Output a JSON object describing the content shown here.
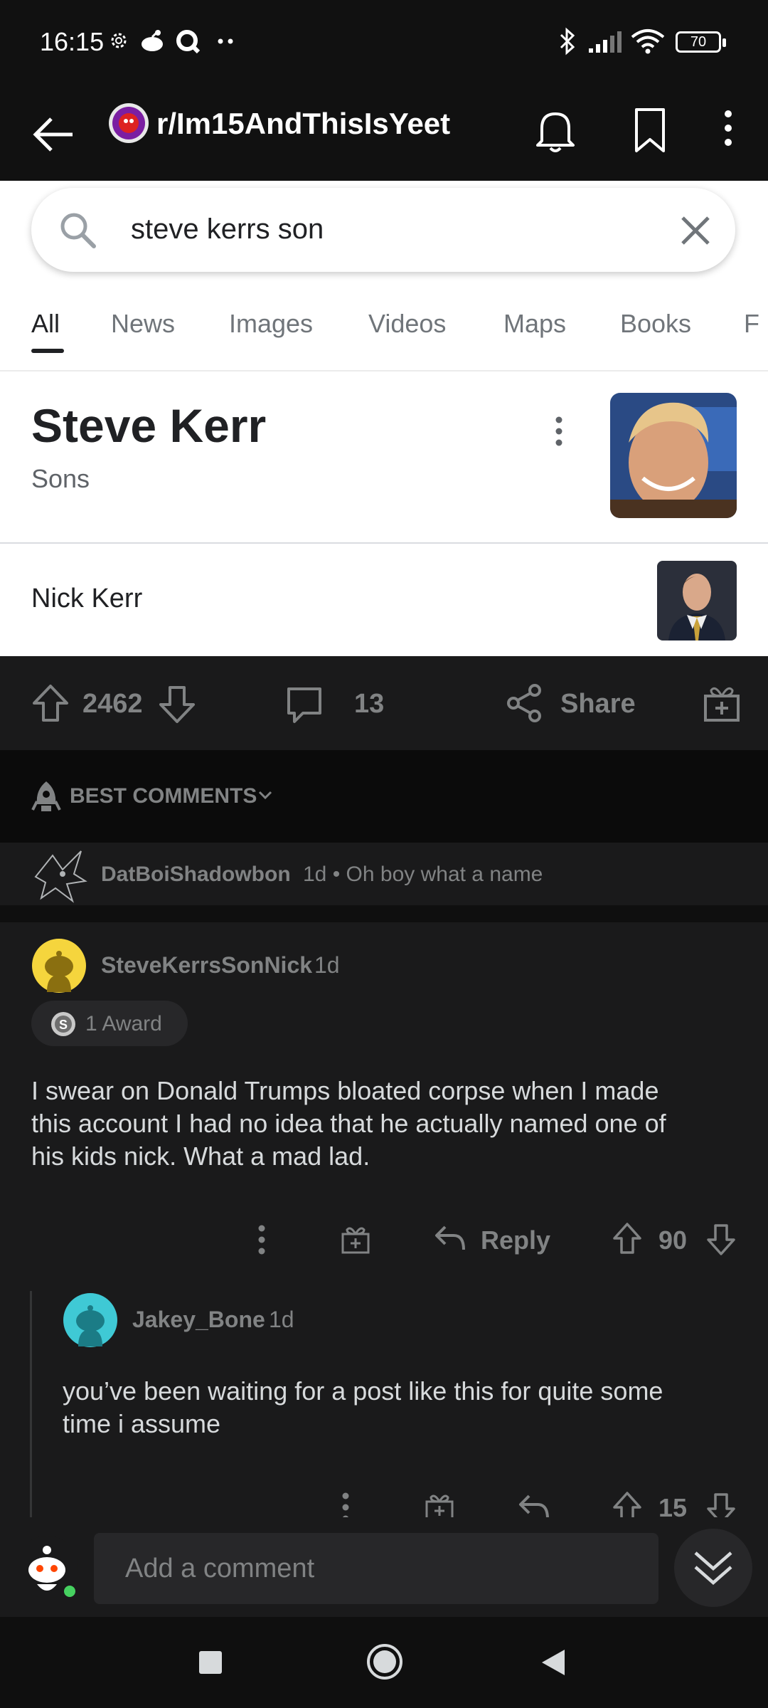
{
  "status_bar": {
    "time": "16:15",
    "battery": "70"
  },
  "header": {
    "subreddit": "r/Im15AndThisIsYeet"
  },
  "google": {
    "query": "steve kerrs son",
    "tabs": [
      "All",
      "News",
      "Images",
      "Videos",
      "Maps",
      "Books",
      "F"
    ],
    "kp_title": "Steve Kerr",
    "kp_subtitle": "Sons",
    "son_name": "Nick Kerr"
  },
  "post_actions": {
    "score": "2462",
    "comments": "13",
    "share": "Share"
  },
  "sort": {
    "label": "BEST COMMENTS"
  },
  "collapsed_comment": {
    "user": "DatBoiShadowbon",
    "meta": "1d • Oh boy what a name"
  },
  "comment": {
    "user": "SteveKerrsSonNick",
    "time": "1d",
    "award": "1 Award",
    "lines": [
      "I swear on Donald Trumps bloated corpse when I made",
      "this account I had no idea that he actually named one of",
      "his kids nick.  What a mad lad."
    ],
    "reply_label": "Reply",
    "score": "90"
  },
  "reply": {
    "user": "Jakey_Bone",
    "time": "1d",
    "lines": [
      "you’ve been waiting for a post like this for quite some",
      "time i assume"
    ],
    "score": "15"
  },
  "composer": {
    "placeholder": "Add a comment"
  },
  "colors": {
    "background": "#1a1a1b",
    "text_muted": "#818384",
    "avatar_yellow": "#f5d53d",
    "avatar_teal": "#3fc9d5"
  }
}
